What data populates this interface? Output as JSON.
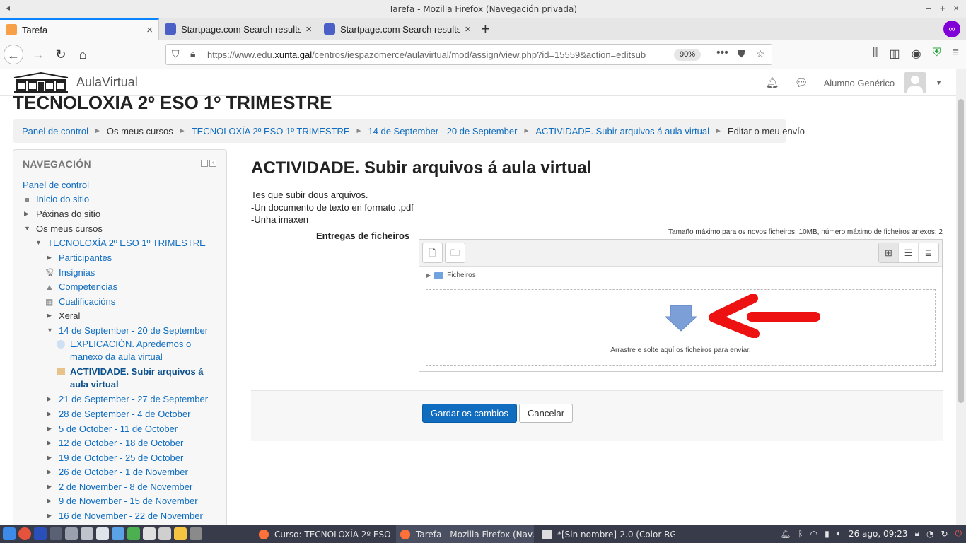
{
  "window": {
    "title": "Tarefa - Mozilla Firefox (Navegación privada)"
  },
  "tabs": [
    {
      "label": "Tarefa",
      "active": true
    },
    {
      "label": "Startpage.com Search results",
      "active": false
    },
    {
      "label": "Startpage.com Search results",
      "active": false
    }
  ],
  "urlbar": {
    "url_prefix": "https://www.edu.",
    "url_domain": "xunta.gal",
    "url_suffix": "/centros/iespazomerce/aulavirtual/mod/assign/view.php?id=15559&action=editsub",
    "zoom": "90%"
  },
  "site": {
    "brand": "AulaVirtual",
    "user_name": "Alumno Genérico"
  },
  "course": {
    "title": "TECNOLOXÍA 2º ESO 1º TRIMESTRE"
  },
  "breadcrumb": [
    {
      "label": "Panel de control",
      "link": true
    },
    {
      "label": "Os meus cursos",
      "link": false
    },
    {
      "label": "TECNOLOXÍA 2º ESO 1º TRIMESTRE",
      "link": true
    },
    {
      "label": "14 de September - 20 de September",
      "link": true
    },
    {
      "label": "ACTIVIDADE. Subir arquivos á aula virtual",
      "link": true
    },
    {
      "label": "Editar o meu envío",
      "link": false
    }
  ],
  "nav": {
    "heading": "NAVEGACIÓN",
    "items": [
      {
        "label": "Panel de control"
      },
      {
        "label": "Inicio do sitio"
      },
      {
        "label": "Páxinas do sitio"
      },
      {
        "label": "Os meus cursos"
      },
      {
        "label": "TECNOLOXÍA 2º ESO 1º TRIMESTRE"
      },
      {
        "label": "Participantes"
      },
      {
        "label": "Insignias"
      },
      {
        "label": "Competencias"
      },
      {
        "label": "Cualificacións"
      },
      {
        "label": "Xeral"
      },
      {
        "label": "14 de September - 20 de September"
      },
      {
        "label": "EXPLICACIÓN. Apredemos o manexo da aula virtual"
      },
      {
        "label": "ACTIVIDADE. Subir arquivos á aula virtual"
      },
      {
        "label": "21 de September - 27 de September"
      },
      {
        "label": "28 de September - 4 de October"
      },
      {
        "label": "5 de October - 11 de October"
      },
      {
        "label": "12 de October - 18 de October"
      },
      {
        "label": "19 de October - 25 de October"
      },
      {
        "label": "26 de October - 1 de November"
      },
      {
        "label": "2 de November - 8 de November"
      },
      {
        "label": "9 de November - 15 de November"
      },
      {
        "label": "16 de November - 22 de November"
      }
    ]
  },
  "assignment": {
    "title": "ACTIVIDADE. Subir arquivos á aula virtual",
    "description": [
      "Tes que subir dous arquivos.",
      "-Un documento de texto en formato .pdf",
      "-Unha imaxen"
    ],
    "field_label": "Entregas de ficheiros",
    "max_size_note": "Tamaño máximo para os novos ficheiros: 10MB, número máximo de ficheiros anexos: 2",
    "folder_label": "Ficheiros",
    "drop_text": "Arrastre e solte aquí os ficheiros para enviar.",
    "save_label": "Gardar os cambios",
    "cancel_label": "Cancelar"
  },
  "taskbar": {
    "tasks": [
      {
        "label": "Curso: TECNOLOXÍA 2º ESO ..."
      },
      {
        "label": "Tarefa - Mozilla Firefox (Nav..."
      },
      {
        "label": "*[Sin nombre]-2.0 (Color RG..."
      }
    ],
    "clock": "26 ago, 09:23"
  },
  "colors": {
    "link": "#0f6cbf",
    "primary_button": "#0f6cbf",
    "private_browsing": "#8000d7",
    "annotation_arrow": "#ee1111"
  }
}
